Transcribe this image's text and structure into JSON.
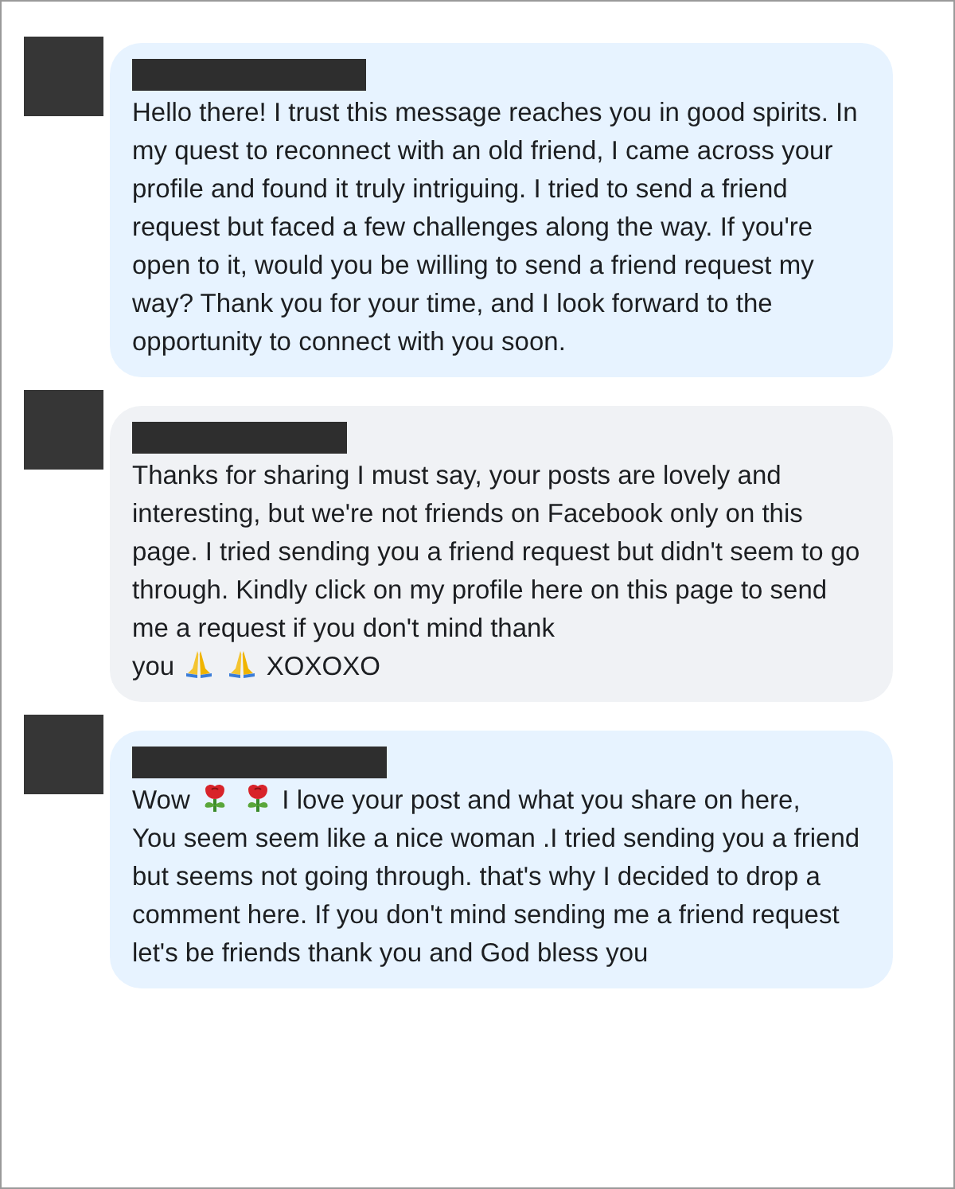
{
  "comments": [
    {
      "color": "#e7f3ff",
      "parts": [
        {
          "kind": "block",
          "text": "Hello there! I trust this message reaches you in good spirits. In my quest to reconnect with an old friend, I came across your profile and found it truly intriguing. I tried to send a friend request but faced a few challenges along the way. If you're open to it, would you be willing to send a friend request my way? Thank you for your time, and I look forward to the opportunity to connect with you soon."
        }
      ]
    },
    {
      "color": "#f0f2f5",
      "parts": [
        {
          "kind": "block",
          "text": "Thanks for sharing I must say, your posts are lovely and interesting, but we're not friends on Facebook only on this page. I tried sending you a friend request but didn't seem to go through. Kindly click on my profile here on this page to send me a request if you don't mind thank"
        },
        {
          "kind": "inline",
          "text": "you"
        },
        {
          "kind": "hands"
        },
        {
          "kind": "hands"
        },
        {
          "kind": "inline",
          "text": "XOXOXO"
        }
      ]
    },
    {
      "color": "#e7f3ff",
      "parts": [
        {
          "kind": "inline",
          "text": "Wow"
        },
        {
          "kind": "rose"
        },
        {
          "kind": "rose"
        },
        {
          "kind": "inline",
          "text": "I love your post and what you share on here,"
        },
        {
          "kind": "block",
          "text": "You seem seem like a nice woman .I tried sending you a friend but seems not going through. that's why I decided to drop a comment here. If you don't mind sending me a friend request let's be friends thank you and God bless you"
        }
      ]
    }
  ]
}
